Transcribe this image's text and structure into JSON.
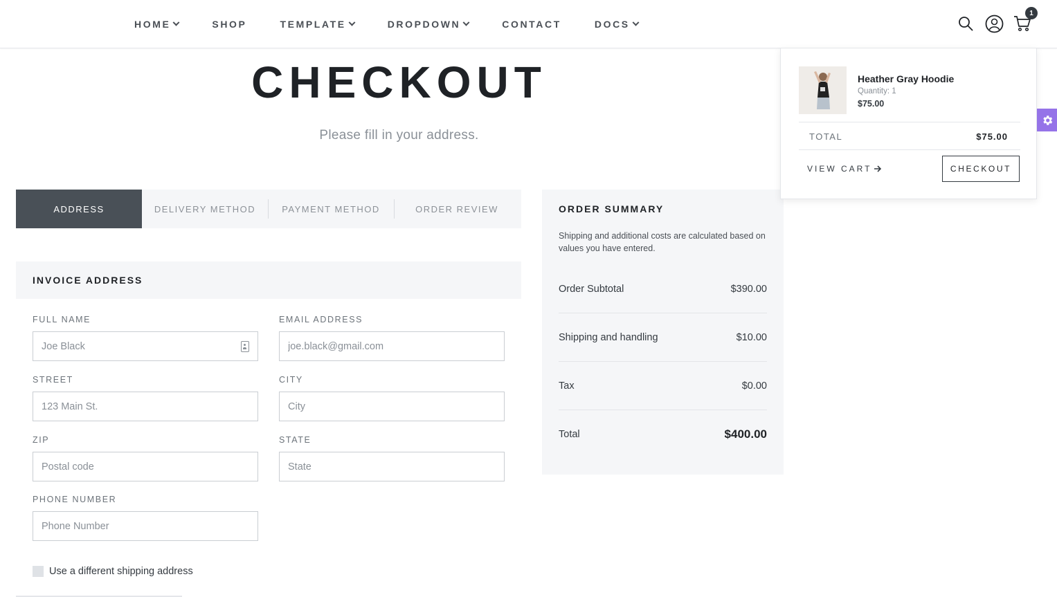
{
  "nav": {
    "items": [
      {
        "label": "HOME",
        "dropdown": true
      },
      {
        "label": "SHOP",
        "dropdown": false
      },
      {
        "label": "TEMPLATE",
        "dropdown": true
      },
      {
        "label": "DROPDOWN",
        "dropdown": true
      },
      {
        "label": "CONTACT",
        "dropdown": false
      },
      {
        "label": "DOCS",
        "dropdown": true
      }
    ],
    "cart_count": "1",
    "icons": [
      "search-icon",
      "user-icon",
      "cart-icon"
    ]
  },
  "page": {
    "title": "CHECKOUT",
    "subtitle": "Please fill in your address."
  },
  "steps": [
    {
      "label": "ADDRESS",
      "active": true
    },
    {
      "label": "DELIVERY METHOD",
      "active": false
    },
    {
      "label": "PAYMENT METHOD",
      "active": false
    },
    {
      "label": "ORDER REVIEW",
      "active": false
    }
  ],
  "invoice": {
    "heading": "INVOICE ADDRESS",
    "fields": {
      "full_name": {
        "label": "FULL NAME",
        "placeholder": "Joe Black"
      },
      "email": {
        "label": "EMAIL ADDRESS",
        "placeholder": "joe.black@gmail.com"
      },
      "street": {
        "label": "STREET",
        "placeholder": "123 Main St."
      },
      "city": {
        "label": "CITY",
        "placeholder": "City"
      },
      "zip": {
        "label": "ZIP",
        "placeholder": "Postal code"
      },
      "state": {
        "label": "STATE",
        "placeholder": "State"
      },
      "phone": {
        "label": "PHONE NUMBER",
        "placeholder": "Phone Number"
      }
    },
    "shipping_checkbox_label": "Use a different shipping address"
  },
  "summary": {
    "title": "ORDER SUMMARY",
    "note": "Shipping and additional costs are calculated based on values you have entered.",
    "rows": [
      {
        "label": "Order Subtotal",
        "value": "$390.00"
      },
      {
        "label": "Shipping and handling",
        "value": "$10.00"
      },
      {
        "label": "Tax",
        "value": "$0.00"
      },
      {
        "label": "Total",
        "value": "$400.00"
      }
    ]
  },
  "mini_cart": {
    "item_name": "Heather Gray Hoodie",
    "item_qty": "Quantity: 1",
    "item_price": "$75.00",
    "total_label": "TOTAL",
    "total_value": "$75.00",
    "view_cart_label": "VIEW CART",
    "checkout_label": "CHECKOUT"
  },
  "colors": {
    "accent_active_step": "#495057",
    "panel_bg": "#f5f6f8",
    "settings_tab": "#9573e8"
  }
}
